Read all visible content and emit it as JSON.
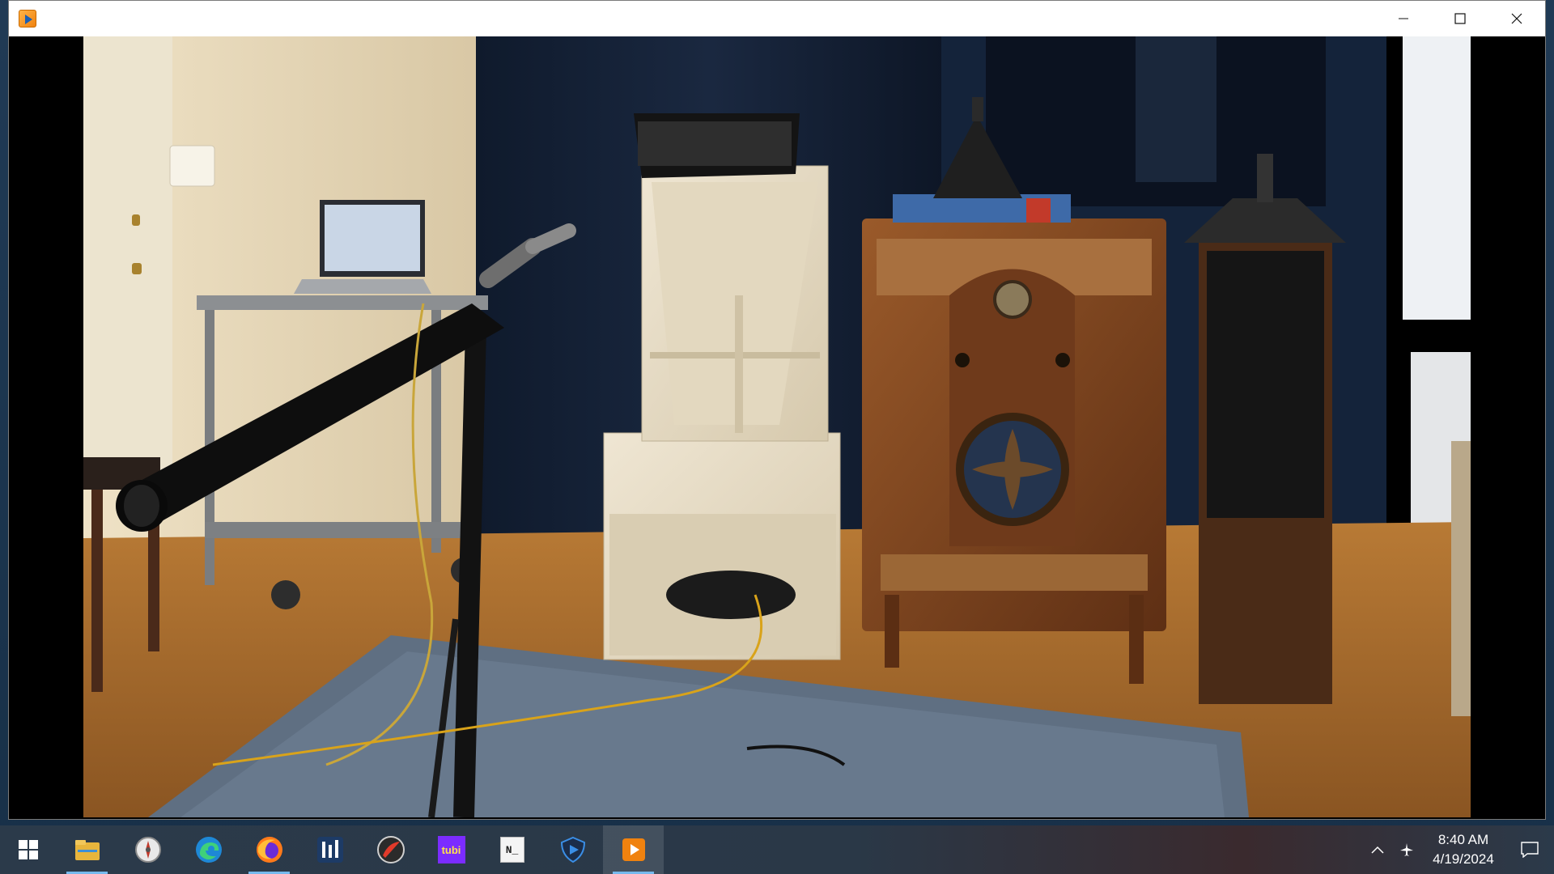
{
  "window": {
    "title": "",
    "controls": [
      "minimize-icon",
      "maximize-icon",
      "close-icon"
    ]
  },
  "taskbar": {
    "apps": [
      {
        "name": "file-explorer-icon",
        "state": "running"
      },
      {
        "name": "browser-compass-icon",
        "state": "idle"
      },
      {
        "name": "edge-icon",
        "state": "idle"
      },
      {
        "name": "firefox-icon",
        "state": "running"
      },
      {
        "name": "audio-mixer-icon",
        "state": "idle"
      },
      {
        "name": "red-compass-icon",
        "state": "idle"
      },
      {
        "name": "tubi-icon",
        "label": "tubi",
        "state": "idle"
      },
      {
        "name": "notepad-icon",
        "label": "N_",
        "state": "idle"
      },
      {
        "name": "media-player-shield-icon",
        "state": "idle"
      },
      {
        "name": "video-player-icon",
        "state": "active"
      }
    ],
    "clock": {
      "time": "8:40 AM",
      "date": "4/19/2024"
    }
  },
  "colors": {
    "taskbar_accent": "#76b9ed",
    "tubi": "#7b2cff",
    "player_orange": "#f0820f"
  }
}
